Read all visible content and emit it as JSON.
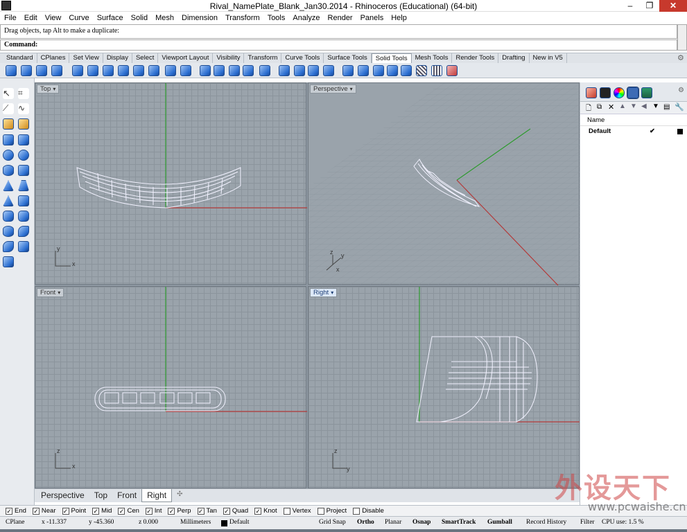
{
  "window": {
    "title": "Rival_NamePlate_Blank_Jan30.2014 - Rhinoceros (Educational) (64-bit)",
    "minimize": "–",
    "maximize": "❐",
    "close": "✕"
  },
  "menu": [
    "File",
    "Edit",
    "View",
    "Curve",
    "Surface",
    "Solid",
    "Mesh",
    "Dimension",
    "Transform",
    "Tools",
    "Analyze",
    "Render",
    "Panels",
    "Help"
  ],
  "command": {
    "history": "Drag objects, tap Alt to make a duplicate:",
    "prompt": "Command:"
  },
  "toolbar_tabs": [
    "Standard",
    "CPlanes",
    "Set View",
    "Display",
    "Select",
    "Viewport Layout",
    "Visibility",
    "Transform",
    "Curve Tools",
    "Surface Tools",
    "Solid Tools",
    "Mesh Tools",
    "Render Tools",
    "Drafting",
    "New in V5"
  ],
  "active_toolbar_tab": "Solid Tools",
  "viewports": {
    "top": {
      "label": "Top",
      "axis_labels": [
        "x",
        "y"
      ]
    },
    "perspective": {
      "label": "Perspective",
      "axis_labels": [
        "x",
        "y",
        "z"
      ]
    },
    "front": {
      "label": "Front",
      "axis_labels": [
        "x",
        "z"
      ]
    },
    "right": {
      "label": "Right",
      "axis_labels": [
        "y",
        "z"
      ]
    }
  },
  "viewport_tabs": [
    "Perspective",
    "Top",
    "Front",
    "Right"
  ],
  "active_viewport_tab": "Right",
  "add_viewport_tab": "✣",
  "layers": {
    "header": "Name",
    "rows": [
      {
        "name": "Default",
        "current": "✔",
        "color": "#000000"
      }
    ]
  },
  "osnaps": [
    {
      "label": "End",
      "checked": true
    },
    {
      "label": "Near",
      "checked": true
    },
    {
      "label": "Point",
      "checked": true
    },
    {
      "label": "Mid",
      "checked": true
    },
    {
      "label": "Cen",
      "checked": true
    },
    {
      "label": "Int",
      "checked": true
    },
    {
      "label": "Perp",
      "checked": true
    },
    {
      "label": "Tan",
      "checked": true
    },
    {
      "label": "Quad",
      "checked": true
    },
    {
      "label": "Knot",
      "checked": true
    },
    {
      "label": "Vertex",
      "checked": false
    },
    {
      "label": "Project",
      "checked": false
    },
    {
      "label": "Disable",
      "checked": false
    }
  ],
  "status": {
    "cplane": "CPlane",
    "x": "x -11.337",
    "y": "y -45.360",
    "z": "z 0.000",
    "units": "Millimeters",
    "layer": "Default",
    "grid_snap": "Grid Snap",
    "ortho": "Ortho",
    "planar": "Planar",
    "osnap": "Osnap",
    "smarttrack": "SmartTrack",
    "gumball": "Gumball",
    "record_history": "Record History",
    "filter": "Filter",
    "cpu": "CPU use: 1.5 %"
  },
  "watermark": {
    "text": "外设天下",
    "url": "www.pcwaishe.cn"
  },
  "colors": {
    "x_axis": "#b33a3a",
    "y_axis": "#2e9a2e",
    "wire": "#f2f2ff",
    "grid_bg": "#9aa3ab"
  }
}
